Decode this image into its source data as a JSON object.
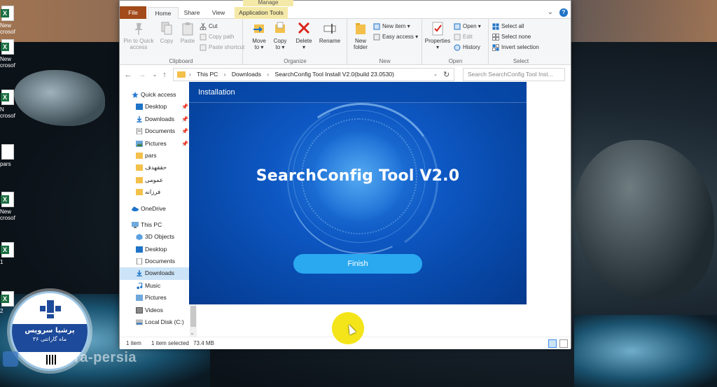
{
  "desktop": {
    "icons": [
      {
        "label": "New\ncrosof",
        "type": "excel"
      },
      {
        "label": "New\ncrosof",
        "type": "excel"
      },
      {
        "label": "N\ncrosof",
        "type": "excel"
      },
      {
        "label": "pars",
        "type": "doc"
      },
      {
        "label": "New\ncrosof",
        "type": "excel"
      },
      {
        "label": "1",
        "type": "excel"
      },
      {
        "label": "2",
        "type": "excel"
      }
    ],
    "badge": {
      "line1": "پرشیا سرویس",
      "line2": "۳۶ ماه گارانتی"
    },
    "watermark": "ra-persia"
  },
  "ribbon_tabs": {
    "contextual_label": "Manage",
    "file": "File",
    "home": "Home",
    "share": "Share",
    "view": "View",
    "app_tools": "Application Tools"
  },
  "ribbon": {
    "clipboard": {
      "name": "Clipboard",
      "pin": "Pin to Quick\naccess",
      "copy": "Copy",
      "paste": "Paste",
      "cut": "Cut",
      "copy_path": "Copy path",
      "paste_shortcut": "Paste shortcut"
    },
    "organize": {
      "name": "Organize",
      "move_to": "Move\nto ▾",
      "copy_to": "Copy\nto ▾",
      "delete": "Delete\n▾",
      "rename": "Rename"
    },
    "new": {
      "name": "New",
      "new_folder": "New\nfolder",
      "new_item": "New item ▾",
      "easy_access": "Easy access ▾"
    },
    "open": {
      "name": "Open",
      "properties": "Properties\n▾",
      "open": "Open ▾",
      "edit": "Edit",
      "history": "History"
    },
    "select": {
      "name": "Select",
      "select_all": "Select all",
      "select_none": "Select none",
      "invert": "Invert selection"
    }
  },
  "address": {
    "crumbs": [
      "This PC",
      "Downloads",
      "SearchConfig Tool Install V2.0(build 23.0530)"
    ],
    "search_placeholder": "Search SearchConfig Tool Inst..."
  },
  "nav": {
    "quick_access": "Quick access",
    "qa_items": [
      "Desktop",
      "Downloads",
      "Documents",
      "Pictures",
      "pars",
      "حققهدف",
      "عمومی",
      "فرزانه"
    ],
    "onedrive": "OneDrive",
    "this_pc": "This PC",
    "pc_items": [
      "3D Objects",
      "Desktop",
      "Documents",
      "Downloads",
      "Music",
      "Pictures",
      "Videos",
      "Local Disk (C:)"
    ]
  },
  "status": {
    "count": "1 item",
    "selected": "1 item selected",
    "size": "73.4 MB"
  },
  "installer": {
    "header": "Installation",
    "product": "SearchConfig Tool V2.0",
    "finish": "Finish"
  },
  "colors": {
    "installer_bg": "#0b55bf",
    "finish_btn": "#2aa8f0",
    "file_tab": "#a34a1a",
    "selected_nav": "#cce4f7"
  }
}
